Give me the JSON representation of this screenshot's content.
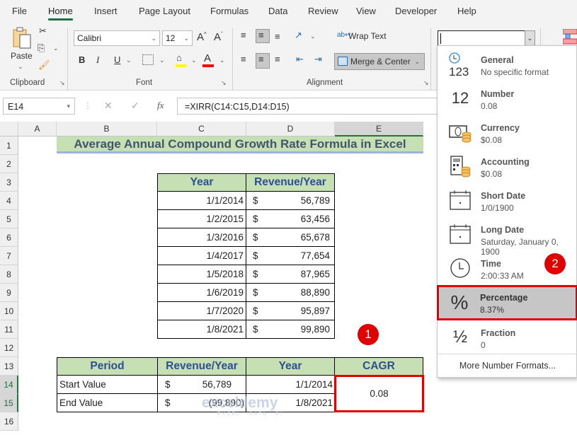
{
  "menu": {
    "tabs": [
      "File",
      "Home",
      "Insert",
      "Page Layout",
      "Formulas",
      "Data",
      "Review",
      "View",
      "Developer",
      "Help"
    ],
    "active": "Home"
  },
  "ribbon": {
    "clipboard": {
      "paste_label": "Paste",
      "group_label": "Clipboard"
    },
    "font": {
      "font_name": "Calibri",
      "font_size": "12",
      "bold": "B",
      "italic": "I",
      "underline": "U",
      "group_label": "Font",
      "highlight_color": "#ffff00",
      "font_color": "#ff0000"
    },
    "alignment": {
      "wrap_text": "Wrap Text",
      "merge_center": "Merge & Center",
      "group_label": "Alignment"
    },
    "number": {
      "format_value": ""
    }
  },
  "formula_bar": {
    "name_box": "E14",
    "cancel": "✕",
    "enter": "✓",
    "fx": "fx",
    "formula": "=XIRR(C14:C15,D14:D15)"
  },
  "columns": [
    "A",
    "B",
    "C",
    "D",
    "E"
  ],
  "selected_column": "E",
  "rows": [
    "1",
    "2",
    "3",
    "4",
    "5",
    "6",
    "7",
    "8",
    "9",
    "10",
    "11",
    "12",
    "13",
    "14",
    "15",
    "16"
  ],
  "sheet": {
    "title": "Average Annual Compound Growth Rate Formula in Excel",
    "table1": {
      "headers": [
        "Year",
        "Revenue/Year"
      ],
      "rows": [
        {
          "year": "1/1/2014",
          "cur": "$",
          "rev": "56,789"
        },
        {
          "year": "1/2/2015",
          "cur": "$",
          "rev": "63,456"
        },
        {
          "year": "1/3/2016",
          "cur": "$",
          "rev": "65,678"
        },
        {
          "year": "1/4/2017",
          "cur": "$",
          "rev": "77,654"
        },
        {
          "year": "1/5/2018",
          "cur": "$",
          "rev": "87,965"
        },
        {
          "year": "1/6/2019",
          "cur": "$",
          "rev": "88,890"
        },
        {
          "year": "1/7/2020",
          "cur": "$",
          "rev": "95,897"
        },
        {
          "year": "1/8/2021",
          "cur": "$",
          "rev": "99,890"
        }
      ]
    },
    "table2": {
      "headers": [
        "Period",
        "Revenue/Year",
        "Year",
        "CAGR"
      ],
      "rows": [
        {
          "period": "Start Value",
          "cur": "$",
          "rev": "56,789",
          "year": "1/1/2014"
        },
        {
          "period": "End Value",
          "cur": "$",
          "rev": "(99,890)",
          "year": "1/8/2021"
        }
      ],
      "cagr": "0.08"
    }
  },
  "number_format_dropdown": {
    "items": [
      {
        "name": "General",
        "sample": "No specific format",
        "icon": "general-123-icon"
      },
      {
        "name": "Number",
        "sample": "0.08",
        "icon": "number-12-icon"
      },
      {
        "name": "Currency",
        "sample": "$0.08",
        "icon": "currency-icon"
      },
      {
        "name": "Accounting",
        "sample": " $0.08",
        "icon": "accounting-icon"
      },
      {
        "name": "Short Date",
        "sample": "1/0/1900",
        "icon": "calendar-icon"
      },
      {
        "name": "Long Date",
        "sample": "Saturday, January 0, 1900",
        "icon": "calendar-icon"
      },
      {
        "name": "Time",
        "sample": "2:00:33 AM",
        "icon": "clock-icon"
      },
      {
        "name": "Percentage",
        "sample": "8.37%",
        "icon": "percent-icon"
      },
      {
        "name": "Fraction",
        "sample": "0",
        "icon": "fraction-icon"
      }
    ],
    "selected": "Percentage",
    "more": "More Number Formats..."
  },
  "annotations": {
    "step1": "1",
    "step2": "2",
    "accent": "#e00000"
  },
  "watermark": {
    "brand": "exceldemy",
    "tagline": "EXCEL · DATA · BI"
  }
}
